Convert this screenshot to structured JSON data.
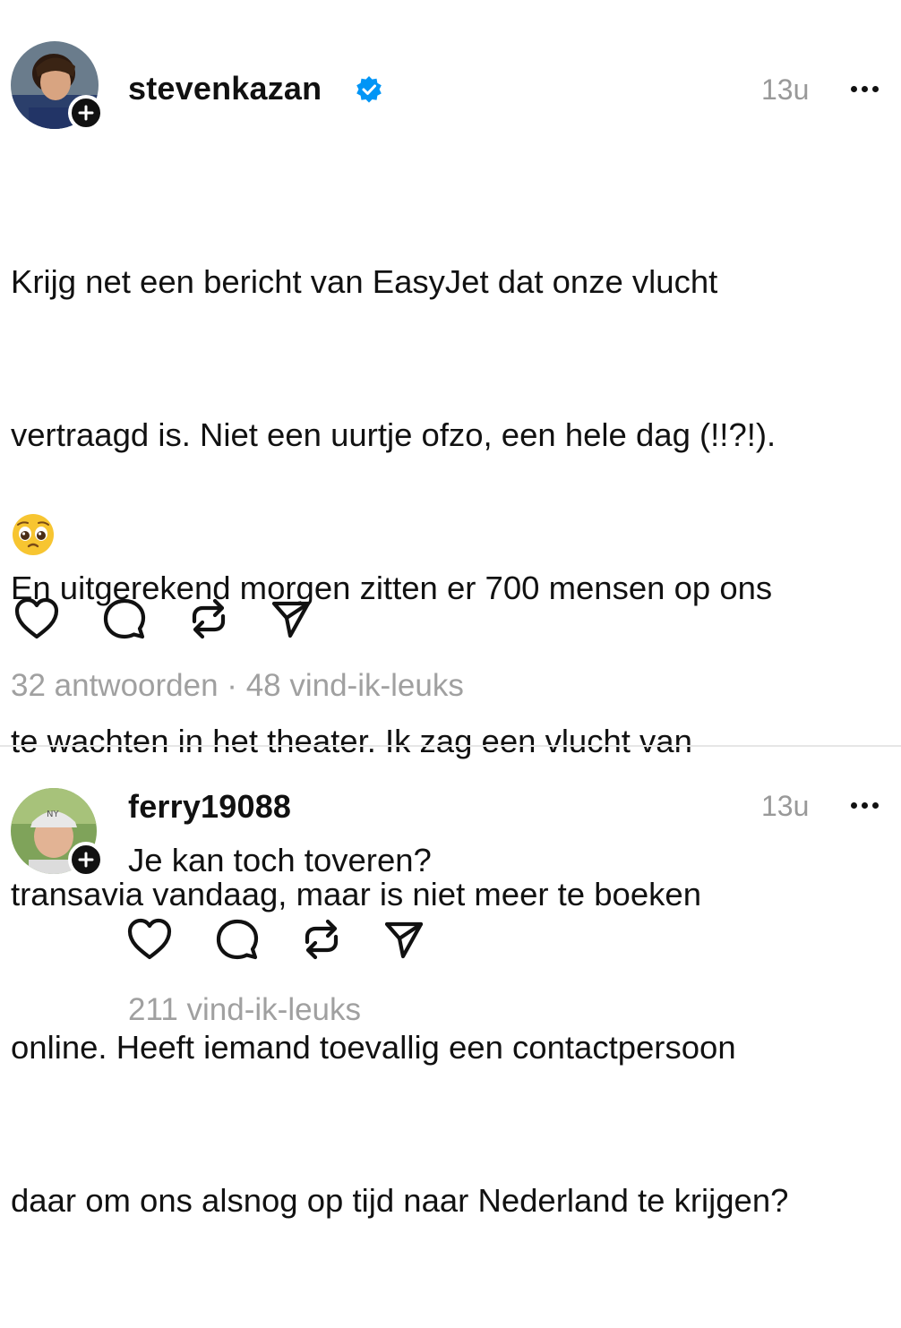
{
  "main_post": {
    "username": "stevenkazan",
    "time": "13u",
    "text_lines": [
      "Krijg net een bericht van EasyJet dat onze vlucht",
      "vertraagd is. Niet een uurtje ofzo, een hele dag (!!?!).",
      "En uitgerekend morgen zitten er 700 mensen op ons",
      "te wachten in het theater. Ik zag een vlucht van",
      "transavia vandaag, maar is niet meer te boeken",
      "online. Heeft iemand toevallig een contactpersoon",
      "daar om ons alsnog op tijd naar Nederland te krijgen?"
    ],
    "emoji": "pleading-face",
    "replies": "32 antwoorden",
    "separator": " · ",
    "likes": "48 vind-ik-leuks",
    "verified": true
  },
  "reply_post": {
    "username": "ferry19088",
    "time": "13u",
    "text": "Je kan toch toveren?",
    "likes": "211 vind-ik-leuks"
  },
  "icons": [
    "heart-icon",
    "comment-icon",
    "repost-icon",
    "share-icon",
    "more-icon",
    "verified-icon",
    "plus-icon"
  ],
  "colors": {
    "verified": "#0095f6",
    "meta": "#999999",
    "text": "#111111"
  }
}
